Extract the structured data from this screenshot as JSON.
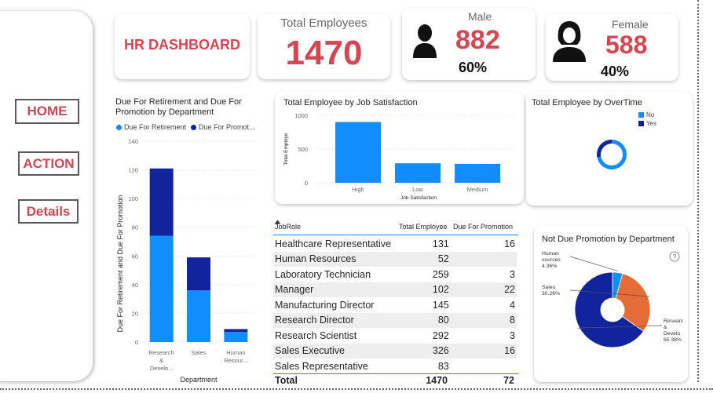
{
  "nav": {
    "home_label": "HOME",
    "action_label": "ACTION",
    "details_label": "Details"
  },
  "kpi": {
    "title": "HR DASHBOARD",
    "total_label": "Total Employees",
    "total_value": "1470",
    "male_label": "Male",
    "male_value": "882",
    "male_pct": "60%",
    "female_label": "Female",
    "female_value": "588",
    "female_pct": "40%"
  },
  "colors": {
    "accent_red": "#d64550",
    "light_blue": "#118dff",
    "dark_blue": "#12239e",
    "orange": "#e66c37"
  },
  "icons": [
    "male-user-icon",
    "female-user-icon",
    "help-icon",
    "sort-icon"
  ],
  "chart_data": [
    {
      "type": "bar",
      "stacked": true,
      "title": "Due For Retirement and Due For Promotion by Department",
      "xlabel": "Department",
      "ylabel": "Due For Retirement and Due For Promotion",
      "ylim": [
        0,
        140
      ],
      "yticks": [
        "0",
        "20",
        "40",
        "60",
        "80",
        "100",
        "120",
        "140"
      ],
      "categories": [
        "Research & Develo...",
        "Sales",
        "Human Resour..."
      ],
      "series": [
        {
          "name": "Due For Retirement",
          "color": "#118dff",
          "values": [
            74,
            36,
            7
          ]
        },
        {
          "name": "Due For Promot...",
          "color": "#12239e",
          "values": [
            47,
            23,
            2
          ]
        }
      ],
      "legend_position": "top-left"
    },
    {
      "type": "bar",
      "title": "Total Employee by Job Satisfaction",
      "xlabel": "Job Satisfaction",
      "ylabel": "Total Employe",
      "ylim": [
        0,
        1000
      ],
      "yticks": [
        "0",
        "500",
        "1000"
      ],
      "categories": [
        "High",
        "Low",
        "Medium"
      ],
      "values": [
        901,
        289,
        280
      ],
      "color": "#118dff"
    },
    {
      "type": "pie",
      "donut": true,
      "title": "Total Employee by OverTime",
      "labels": [
        "No",
        "Yes"
      ],
      "colors": [
        "#118dff",
        "#12239e"
      ],
      "values": [
        72,
        28
      ],
      "legend_position": "top-right"
    },
    {
      "type": "table",
      "headers": [
        "JobRole",
        "Total Employee",
        "Due For Promotion"
      ],
      "rows": [
        [
          "Healthcare Representative",
          "131",
          "16"
        ],
        [
          "Human Resources",
          "52",
          ""
        ],
        [
          "Laboratory Technician",
          "259",
          "3"
        ],
        [
          "Manager",
          "102",
          "22"
        ],
        [
          "Manufacturing Director",
          "145",
          "4"
        ],
        [
          "Research Director",
          "80",
          "8"
        ],
        [
          "Research Scientist",
          "292",
          "3"
        ],
        [
          "Sales Executive",
          "326",
          "16"
        ],
        [
          "Sales Representative",
          "83",
          ""
        ]
      ],
      "total": [
        "Total",
        "1470",
        "72"
      ]
    },
    {
      "type": "pie",
      "donut": true,
      "title": "Not Due Promotion by Department",
      "labels": [
        "Human Resources",
        "Sales",
        "Research & Develo..."
      ],
      "label_texts": [
        [
          "Human",
          "sources",
          "4.36%"
        ],
        [
          "Sales",
          "30.26%"
        ],
        [
          "Researc",
          "&",
          "Develo",
          "65.38%"
        ]
      ],
      "values": [
        4.36,
        30.26,
        65.38
      ],
      "colors": [
        "#118dff",
        "#e66c37",
        "#12239e"
      ]
    }
  ]
}
